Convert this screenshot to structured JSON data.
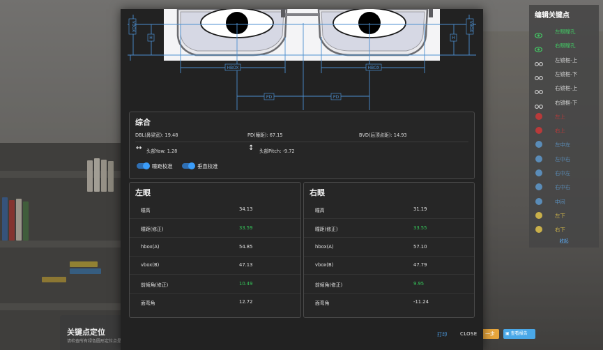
{
  "background": {
    "card_title": "关键点定位",
    "card_hint": "请检查所有绿色圆形定位点是",
    "prev_button": "一步",
    "report_button": "查看报告"
  },
  "diagram": {
    "labels": {
      "hbox_left": "HBOX",
      "hbox_right": "HBOX",
      "pd_left": "PD",
      "pd_right": "PD",
      "vbox_left": "VBOX",
      "vbox_right": "VBOX",
      "h_left": "H",
      "h_right": "H"
    }
  },
  "summary": {
    "title": "综合",
    "dbl": "DBL(鼻梁宽): 19.48",
    "pd": "PD(瞳距): 67.15",
    "bvd": "BVD(后顶点距): 14.93",
    "yaw": "头部Yaw: 1.28",
    "pitch": "头部Pitch: -9.72",
    "toggle1": "瞳距校准",
    "toggle2": "垂直校准"
  },
  "left_eye": {
    "title": "左眼",
    "rows": [
      {
        "k": "瞳高",
        "v": "34.13",
        "green": false
      },
      {
        "k": "瞳距(修正)",
        "v": "33.59",
        "green": true
      },
      {
        "k": "hbox(A)",
        "v": "54.85",
        "green": false
      },
      {
        "k": "vbox(B)",
        "v": "47.13",
        "green": false
      },
      {
        "k": "前倾角(修正)",
        "v": "10.49",
        "green": true
      },
      {
        "k": "面弯角",
        "v": "12.72",
        "green": false
      }
    ]
  },
  "right_eye": {
    "title": "右眼",
    "rows": [
      {
        "k": "瞳高",
        "v": "31.19",
        "green": false
      },
      {
        "k": "瞳距(修正)",
        "v": "33.55",
        "green": true
      },
      {
        "k": "hbox(A)",
        "v": "57.10",
        "green": false
      },
      {
        "k": "vbox(B)",
        "v": "47.79",
        "green": false
      },
      {
        "k": "前倾角(修正)",
        "v": "9.95",
        "green": true
      },
      {
        "k": "面弯角",
        "v": "-11.24",
        "green": false
      }
    ]
  },
  "footer": {
    "print": "打印",
    "close": "CLOSE"
  },
  "keypoints": {
    "title": "编辑关键点",
    "items": [
      {
        "label": "左眼瞳孔",
        "icon": "eye-icon",
        "color": "#43c463"
      },
      {
        "label": "右眼瞳孔",
        "icon": "eye-icon",
        "color": "#43c463"
      },
      {
        "label": "左镜框-上",
        "icon": "glasses-icon",
        "color": "#d4d4d4"
      },
      {
        "label": "左镜框-下",
        "icon": "glasses-icon",
        "color": "#d4d4d4"
      },
      {
        "label": "右镜框-上",
        "icon": "glasses-icon",
        "color": "#d4d4d4"
      },
      {
        "label": "右镜框-下",
        "icon": "glasses-icon",
        "color": "#d4d4d4"
      },
      {
        "label": "左上",
        "icon": "dot-icon",
        "color": "#b83a3a"
      },
      {
        "label": "右上",
        "icon": "dot-icon",
        "color": "#b83a3a"
      },
      {
        "label": "左中左",
        "icon": "dot-icon",
        "color": "#5a8cb8"
      },
      {
        "label": "左中右",
        "icon": "dot-icon",
        "color": "#5a8cb8"
      },
      {
        "label": "右中左",
        "icon": "dot-icon",
        "color": "#5a8cb8"
      },
      {
        "label": "右中右",
        "icon": "dot-icon",
        "color": "#5a8cb8"
      },
      {
        "label": "中间",
        "icon": "dot-icon",
        "color": "#5a8cb8"
      },
      {
        "label": "左下",
        "icon": "dot-icon",
        "color": "#c9b04a"
      },
      {
        "label": "右下",
        "icon": "dot-icon",
        "color": "#c9b04a"
      }
    ],
    "collapse": "收起"
  }
}
